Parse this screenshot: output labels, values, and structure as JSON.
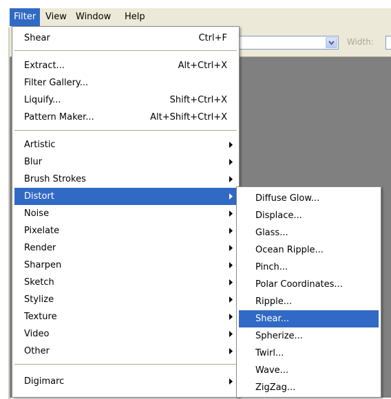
{
  "menubar": {
    "items": [
      {
        "label": "Filter",
        "active": true
      },
      {
        "label": "View"
      },
      {
        "label": "Window"
      },
      {
        "label": "Help"
      }
    ]
  },
  "toolbar": {
    "width_label": "Width:"
  },
  "filter_menu": {
    "items": [
      {
        "label": "Shear",
        "shortcut": "Ctrl+F"
      },
      {
        "label": "Extract...",
        "shortcut": "Alt+Ctrl+X"
      },
      {
        "label": "Filter Gallery...",
        "shortcut": ""
      },
      {
        "label": "Liquify...",
        "shortcut": "Shift+Ctrl+X"
      },
      {
        "label": "Pattern Maker...",
        "shortcut": "Alt+Shift+Ctrl+X"
      },
      {
        "label": "Artistic",
        "submenu": true
      },
      {
        "label": "Blur",
        "submenu": true
      },
      {
        "label": "Brush Strokes",
        "submenu": true
      },
      {
        "label": "Distort",
        "submenu": true,
        "highlighted": true
      },
      {
        "label": "Noise",
        "submenu": true
      },
      {
        "label": "Pixelate",
        "submenu": true
      },
      {
        "label": "Render",
        "submenu": true
      },
      {
        "label": "Sharpen",
        "submenu": true
      },
      {
        "label": "Sketch",
        "submenu": true
      },
      {
        "label": "Stylize",
        "submenu": true
      },
      {
        "label": "Texture",
        "submenu": true
      },
      {
        "label": "Video",
        "submenu": true
      },
      {
        "label": "Other",
        "submenu": true
      },
      {
        "label": "Digimarc",
        "submenu": true
      }
    ]
  },
  "distort_submenu": {
    "items": [
      {
        "label": "Diffuse Glow..."
      },
      {
        "label": "Displace..."
      },
      {
        "label": "Glass..."
      },
      {
        "label": "Ocean Ripple..."
      },
      {
        "label": "Pinch..."
      },
      {
        "label": "Polar Coordinates..."
      },
      {
        "label": "Ripple..."
      },
      {
        "label": "Shear...",
        "highlighted": true
      },
      {
        "label": "Spherize..."
      },
      {
        "label": "Twirl..."
      },
      {
        "label": "Wave..."
      },
      {
        "label": "ZigZag..."
      }
    ]
  },
  "icons": {
    "submenu_arrow": "triangle-right-icon",
    "combo_arrow": "chevron-down-icon"
  },
  "colors": {
    "highlight": "#316ac5",
    "menubar_bg": "#ece9d8",
    "canvas": "#808080"
  }
}
